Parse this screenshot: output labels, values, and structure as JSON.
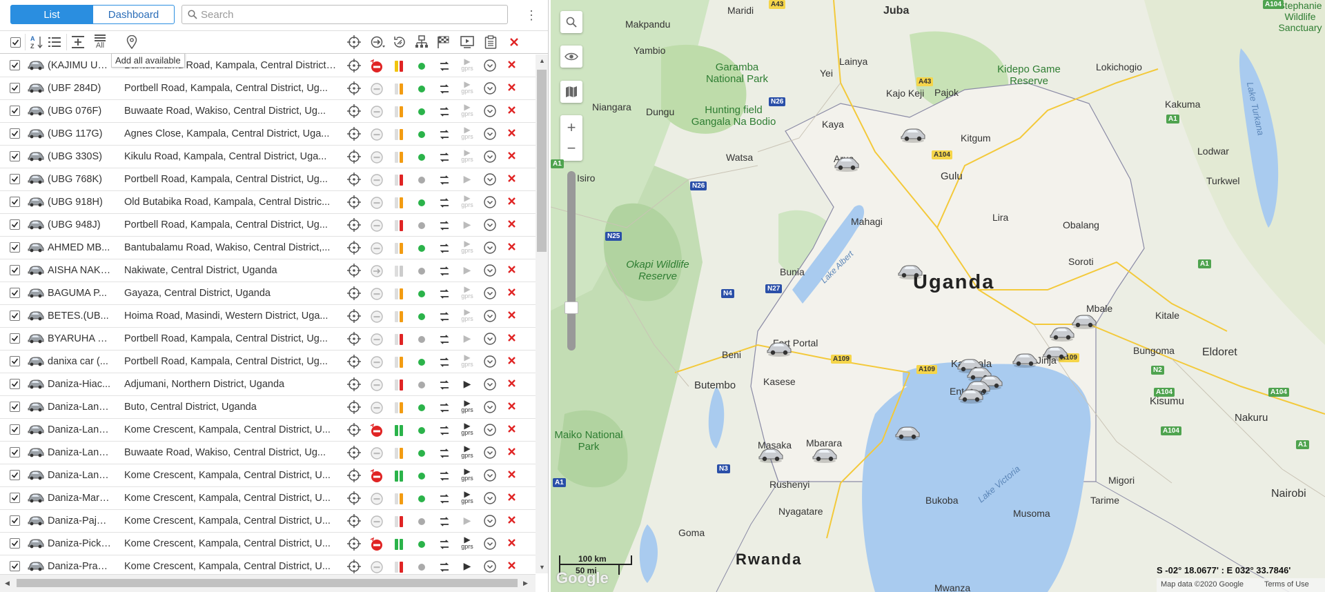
{
  "view_tabs": {
    "list": "List",
    "dashboard": "Dashboard"
  },
  "search": {
    "placeholder": "Search"
  },
  "tooltip": "Add all available",
  "toolbar": {
    "all_label": "All"
  },
  "vehicles": [
    {
      "name": "(KAJIMU UB...",
      "address": "Bantubalamu Road, Kampala, Central District, ...",
      "state_icon": "no-entry",
      "signal": "yellow-red",
      "status": "green",
      "gprs": true
    },
    {
      "name": "(UBF 284D)",
      "address": "Portbell Road, Kampala, Central District, Ug...",
      "state_icon": "minus",
      "signal": "orange",
      "status": "green",
      "gprs": true
    },
    {
      "name": "(UBG 076F)",
      "address": "Buwaate Road, Wakiso, Central District, Ug...",
      "state_icon": "minus",
      "signal": "orange",
      "status": "green",
      "gprs": true
    },
    {
      "name": "(UBG 117G)",
      "address": "Agnes Close, Kampala, Central District, Uga...",
      "state_icon": "minus",
      "signal": "orange",
      "status": "green",
      "gprs": true
    },
    {
      "name": "(UBG 330S)",
      "address": "Kikulu Road, Kampala, Central District, Uga...",
      "state_icon": "minus",
      "signal": "orange",
      "status": "green",
      "gprs": true
    },
    {
      "name": "(UBG 768K)",
      "address": "Portbell Road, Kampala, Central District, Ug...",
      "state_icon": "minus",
      "signal": "red",
      "status": "gray",
      "gprs": false
    },
    {
      "name": "(UBG 918H)",
      "address": "Old Butabika Road, Kampala, Central Distric...",
      "state_icon": "minus",
      "signal": "orange",
      "status": "green",
      "gprs": true
    },
    {
      "name": "(UBG 948J)",
      "address": "Portbell Road, Kampala, Central District, Ug...",
      "state_icon": "minus",
      "signal": "red",
      "status": "gray",
      "gprs": false
    },
    {
      "name": "AHMED MB...",
      "address": "Bantubalamu Road, Wakiso, Central District,...",
      "state_icon": "minus",
      "signal": "orange",
      "status": "green",
      "gprs": true
    },
    {
      "name": "AISHA NAKI...",
      "address": "Nakiwate, Central District, Uganda",
      "state_icon": "arrow",
      "signal": "gray",
      "status": "gray",
      "gprs": false
    },
    {
      "name": "BAGUMA P...",
      "address": "Gayaza, Central District, Uganda",
      "state_icon": "minus",
      "signal": "orange",
      "status": "green",
      "gprs": true
    },
    {
      "name": "BETES.(UB...",
      "address": "Hoima Road, Masindi, Western District, Uga...",
      "state_icon": "minus",
      "signal": "orange",
      "status": "green",
      "gprs": true
    },
    {
      "name": "BYARUHA K...",
      "address": "Portbell Road, Kampala, Central District, Ug...",
      "state_icon": "minus",
      "signal": "red",
      "status": "gray",
      "gprs": false
    },
    {
      "name": "danixa car (...",
      "address": "Portbell Road, Kampala, Central District, Ug...",
      "state_icon": "minus",
      "signal": "orange",
      "status": "green",
      "gprs": true
    },
    {
      "name": "Daniza-Hiac...",
      "address": "Adjumani, Northern District, Uganda",
      "state_icon": "minus",
      "signal": "red",
      "status": "gray",
      "gprs": false,
      "dark_play": true
    },
    {
      "name": "Daniza-Land...",
      "address": "Buto, Central District, Uganda",
      "state_icon": "minus",
      "signal": "orange",
      "status": "green",
      "gprs": true,
      "dark_play": true
    },
    {
      "name": "Daniza-Land...",
      "address": "Kome Crescent, Kampala, Central District, U...",
      "state_icon": "no-entry",
      "signal": "green",
      "status": "green",
      "gprs": true,
      "dark_play": true
    },
    {
      "name": "Daniza-Land...",
      "address": "Buwaate Road, Wakiso, Central District, Ug...",
      "state_icon": "minus",
      "signal": "orange",
      "status": "green",
      "gprs": true,
      "dark_play": true
    },
    {
      "name": "Daniza-Land...",
      "address": "Kome Crescent, Kampala, Central District, U...",
      "state_icon": "no-entry",
      "signal": "green",
      "status": "green",
      "gprs": true,
      "dark_play": true
    },
    {
      "name": "Daniza-Mark...",
      "address": "Kome Crescent, Kampala, Central District, U...",
      "state_icon": "minus",
      "signal": "orange",
      "status": "green",
      "gprs": true,
      "dark_play": true
    },
    {
      "name": "Daniza-Pajer...",
      "address": "Kome Crescent, Kampala, Central District, U...",
      "state_icon": "minus",
      "signal": "red",
      "status": "gray",
      "gprs": false
    },
    {
      "name": "Daniza-Pick ...",
      "address": "Kome Crescent, Kampala, Central District, U...",
      "state_icon": "no-entry",
      "signal": "green",
      "status": "green",
      "gprs": true,
      "dark_play": true
    },
    {
      "name": "Daniza-Prad...",
      "address": "Kome Crescent, Kampala, Central District, U...",
      "state_icon": "minus",
      "signal": "red",
      "status": "gray",
      "gprs": false,
      "dark_play": true
    }
  ],
  "gprs_label": "gprs",
  "colors": {
    "accent": "#2a8ee0",
    "green": "#2bb34a",
    "red": "#e02424",
    "orange": "#f39c12",
    "gray": "#aaaaaa"
  },
  "map": {
    "country_label": "Uganda",
    "rwanda_label": "Rwanda",
    "cities": [
      "Juba",
      "Makpandu",
      "Yambio",
      "Maridi",
      "Yei",
      "Lainya",
      "Kajo Keji",
      "Pajok",
      "Niangara",
      "Dungu",
      "Kaya",
      "Arua",
      "Kitgum",
      "Lokichogio",
      "Kakuma",
      "Lodwar",
      "Watsa",
      "Gulu",
      "Isiro",
      "Turkwel",
      "Mahagi",
      "Lira",
      "Obalang",
      "Bunia",
      "Soroti",
      "Mbale",
      "Kitale",
      "Fort Portal",
      "Kampala",
      "Jinja",
      "Bungoma",
      "Eldoret",
      "Beni",
      "Kasese",
      "Butembo",
      "Entebbe",
      "Kisumu",
      "Nakuru",
      "Masaka",
      "Mbarara",
      "Rushenyi",
      "Migori",
      "Bukoba",
      "Musoma",
      "Tarime",
      "Nairobi",
      "Nyagatare",
      "Goma",
      "Mwanza"
    ],
    "parks": [
      "Garamba National Park",
      "Hunting field Gangala Na Bodio",
      "Kidepo Game Reserve",
      "Okapi Wildlife Reserve",
      "Maiko National Park",
      "Stephanie Wildlife Sanctuary"
    ],
    "lakes": [
      "Lake Albert",
      "Lake Victoria",
      "Lake Turkana"
    ],
    "roads": [
      "A43",
      "N26",
      "A43",
      "A104",
      "N26",
      "N25",
      "N4",
      "N27",
      "A109",
      "A109",
      "A109",
      "A1",
      "A104",
      "A1",
      "A104",
      "N2",
      "N3",
      "A1",
      "A104",
      "A104",
      "A1",
      "A1"
    ],
    "scale": {
      "km": "100 km",
      "mi": "50 mi"
    },
    "coords": "S -02° 18.0677' : E 032° 33.7846'",
    "attribution": "Map data ©2020 Google",
    "terms": "Terms of Use",
    "google": "Google"
  }
}
